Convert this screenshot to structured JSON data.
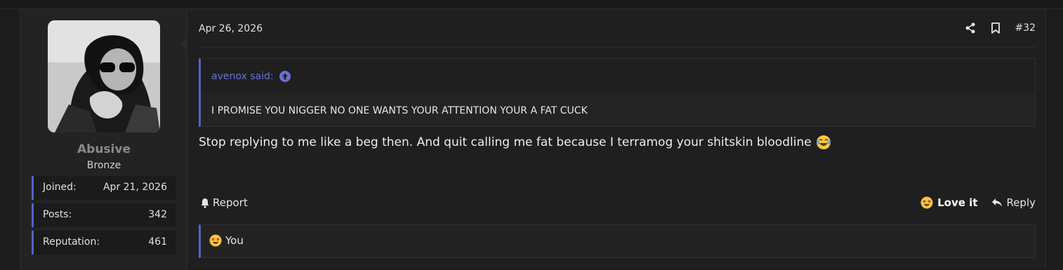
{
  "post": {
    "date": "Apr 26, 2026",
    "post_number": "#32",
    "user": {
      "name": "Abusive",
      "title": "Bronze",
      "stats": [
        {
          "label": "Joined:",
          "value": "Apr 21, 2026"
        },
        {
          "label": "Posts:",
          "value": "342"
        },
        {
          "label": "Reputation:",
          "value": "461"
        }
      ]
    },
    "quote": {
      "author": "avenox said:",
      "text": "I PROMISE YOU NIGGER NO ONE WANTS YOUR ATTENTION YOUR A FAT CUCK"
    },
    "message": "Stop replying to me like a beg then. And quit calling me fat because I terramog your shitskin bloodline",
    "actions": {
      "report": "Report",
      "love": "Love it",
      "reply": "Reply"
    },
    "reactions": {
      "label": "You"
    }
  },
  "colors": {
    "accent": "#5a5fc7",
    "quote_author": "#6a6fd6",
    "background": "#1c1c1c",
    "panel": "#232323"
  },
  "icons": [
    "share-icon",
    "bookmark-icon",
    "arrow-up-circle-icon",
    "bell-icon",
    "star-eyes-emoji-icon",
    "reply-arrow-icon",
    "laughing-crying-emoji-icon"
  ]
}
